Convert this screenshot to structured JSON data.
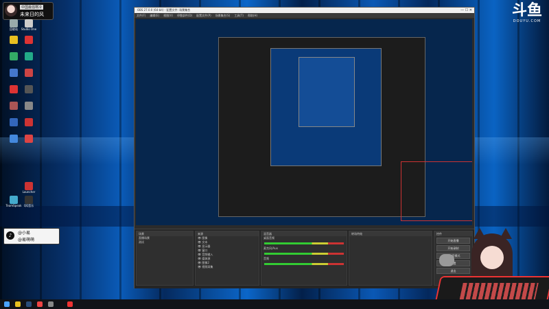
{
  "streamer": {
    "tag": "中国最强寒冷",
    "name": "未来日的风"
  },
  "douyu": {
    "logo_text": "斗鱼",
    "domain": "DOUYU.COM"
  },
  "tiktok": {
    "line1": "@小易",
    "line2": "@易萌萌"
  },
  "desktop_icons": [
    {
      "label": "回收站",
      "color": "#9aa"
    },
    {
      "label": "Studio One",
      "color": "#ccc"
    },
    {
      "label": "",
      "color": "#e8c020"
    },
    {
      "label": "",
      "color": "#d33"
    },
    {
      "label": "",
      "color": "#3a6"
    },
    {
      "label": "",
      "color": "#2a8"
    },
    {
      "label": "",
      "color": "#47c"
    },
    {
      "label": "",
      "color": "#c44"
    },
    {
      "label": "",
      "color": "#d33"
    },
    {
      "label": "",
      "color": "#555"
    },
    {
      "label": "",
      "color": "#a55"
    },
    {
      "label": "",
      "color": "#888"
    },
    {
      "label": "",
      "color": "#36b"
    },
    {
      "label": "",
      "color": "#c33"
    },
    {
      "label": "",
      "color": "#48d"
    },
    {
      "label": "",
      "color": "#d44"
    },
    {
      "label": "Launcher",
      "color": "#c33"
    },
    {
      "label": "TeamSpeak",
      "color": "#4ac"
    },
    {
      "label": "QQ音乐",
      "color": "#333"
    }
  ],
  "obs": {
    "title": "OBS 27.0.0 (64-bit) - 配置文件: 场景集合",
    "menu": [
      "文件(F)",
      "编辑(E)",
      "视图(V)",
      "停靠部件(D)",
      "配置文件(P)",
      "场景集合(S)",
      "工具(T)",
      "帮助(H)"
    ],
    "docks": {
      "scenes": {
        "header": "场景",
        "items": [
          "直播场景",
          "测试"
        ]
      },
      "sources": {
        "header": "来源",
        "items": [
          "图像",
          "文本",
          "显示器",
          "窗口",
          "音频输入",
          "媒体源",
          "图像2",
          "视频采集"
        ]
      },
      "mixer": {
        "header": "混音器",
        "tracks": [
          "桌面音频",
          "麦克风/Aux",
          "音频"
        ]
      },
      "transitions": {
        "header": "转场特效"
      },
      "controls": {
        "header": "控件",
        "buttons": [
          "开始直播",
          "开始录制",
          "工作室模式",
          "设置",
          "退出"
        ]
      }
    }
  },
  "taskbar_icons": [
    {
      "name": "windows-start-icon",
      "color": "#4aa3ff"
    },
    {
      "name": "file-explorer-icon",
      "color": "#e8c020"
    },
    {
      "name": "steam-icon",
      "color": "#2a4d7a"
    },
    {
      "name": "browser-icon",
      "color": "#e44"
    },
    {
      "name": "obs-icon",
      "color": "#888"
    },
    {
      "name": "app-icon",
      "color": "#e33"
    }
  ]
}
